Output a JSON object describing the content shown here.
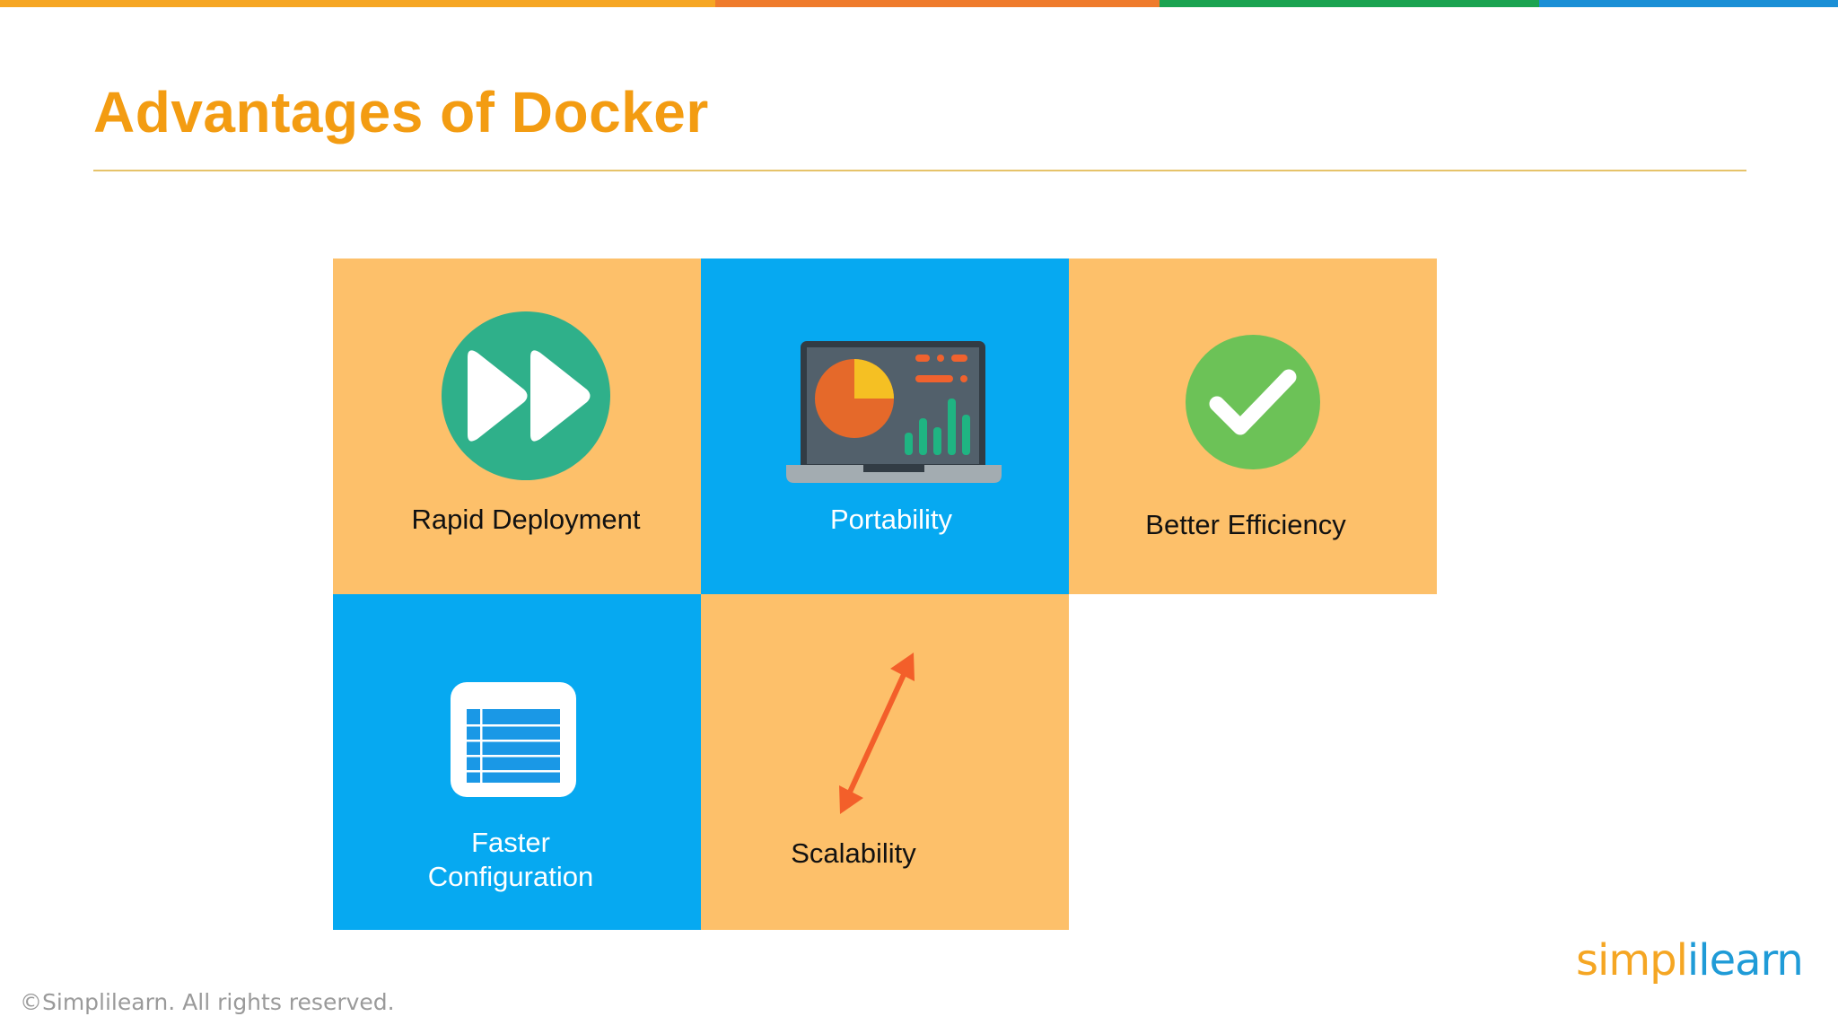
{
  "slide": {
    "title": "Advantages of Docker",
    "footer": "©Simplilearn. All rights reserved.",
    "brand": {
      "part1": "simpl",
      "part2": "ilearn"
    },
    "accent_colors": {
      "title": "#f39c12",
      "orange_tile": "#fdc06a",
      "blue_tile": "#06a9f1",
      "bar": [
        "#f6a623",
        "#ef7b2c",
        "#1aa350",
        "#1a8fd6"
      ]
    }
  },
  "tiles": [
    {
      "label": "Rapid Deployment",
      "icon": "fast-forward-icon",
      "color": "orange"
    },
    {
      "label": "Portability",
      "icon": "laptop-dashboard-icon",
      "color": "blue"
    },
    {
      "label": "Better Efficiency",
      "icon": "checkmark-icon",
      "color": "orange"
    },
    {
      "label_line1": "Faster",
      "label_line2": "Configuration",
      "icon": "table-icon",
      "color": "blue"
    },
    {
      "label": "Scalability",
      "icon": "double-arrow-icon",
      "color": "orange"
    }
  ]
}
